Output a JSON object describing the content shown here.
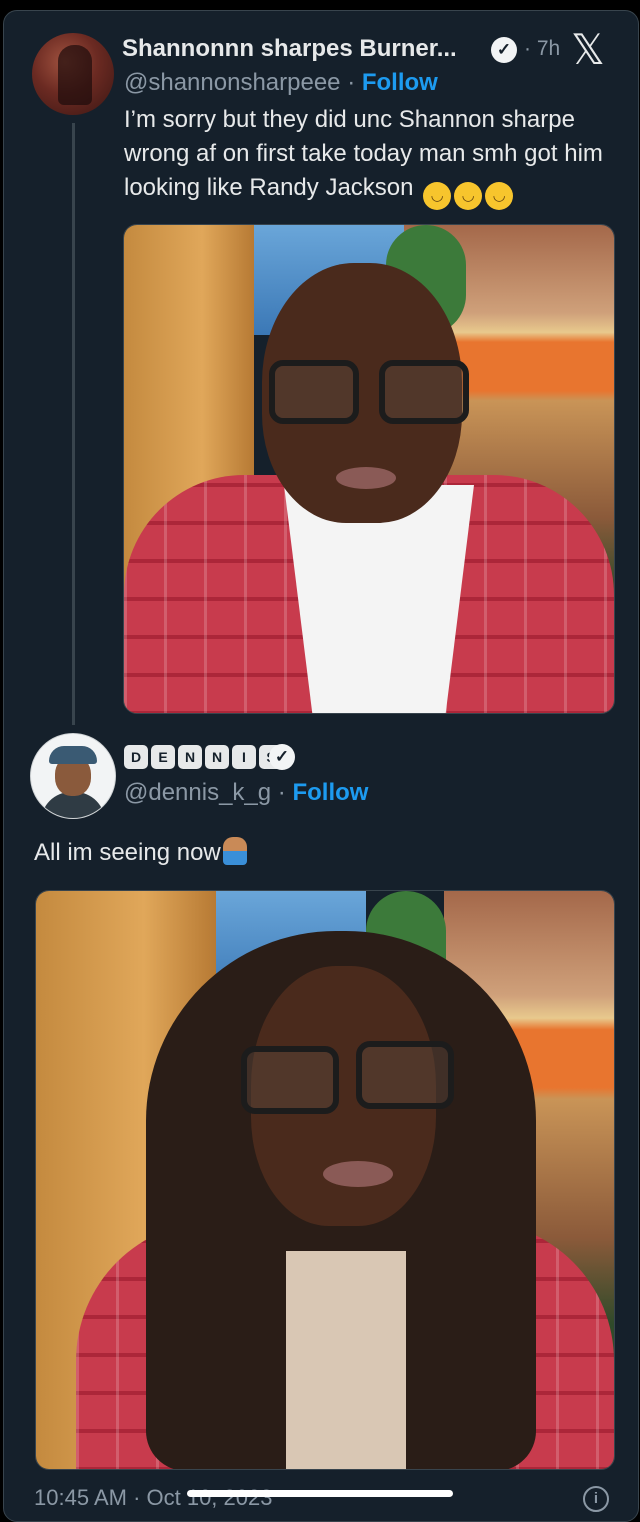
{
  "tweet1": {
    "display_name": "Shannonnn sharpes Burner...",
    "verified_icon": "verified-badge-icon",
    "time": "· 7h",
    "platform_icon": "x-logo-icon",
    "platform_glyph": "𝕏",
    "handle": "@shannonsharpeee",
    "separator": " · ",
    "follow": "Follow",
    "text": "I’m sorry but they did unc Shannon sharpe wrong af on first take today man smh got him looking like Randy Jackson",
    "emoji_icon": "weary-face-emoji",
    "emoji_count": 3
  },
  "tweet2": {
    "display_name_letters": [
      "D",
      "E",
      "N",
      "N",
      "I",
      "S"
    ],
    "verified_icon": "verified-badge-icon",
    "handle": "@dennis_k_g",
    "separator": " · ",
    "follow": "Follow",
    "text": "All im seeing now",
    "emoji_icon": "person-facepalming-emoji"
  },
  "footer": {
    "timestamp": "10:45 AM · Oct 10, 2023",
    "info_icon": "info-circle-icon"
  },
  "colors": {
    "background": "#15202b",
    "text": "#e7e9ea",
    "muted": "#8b98a5",
    "accent": "#1d9bf0",
    "border": "#38444d"
  }
}
